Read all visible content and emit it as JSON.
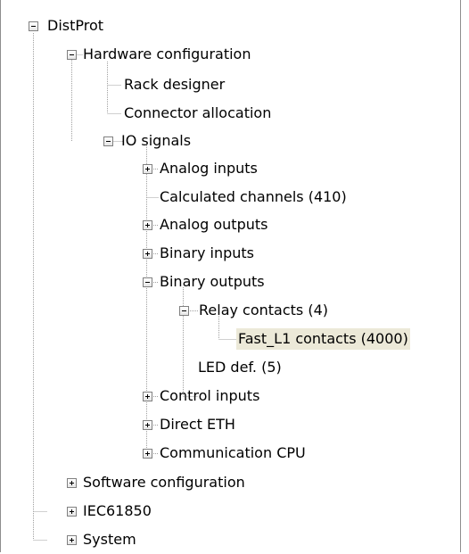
{
  "tree": {
    "nodes": [
      {
        "label": "DistProt",
        "expander": "minus"
      },
      {
        "label": "Hardware configuration",
        "expander": "minus"
      },
      {
        "label": "Rack designer",
        "expander": "none"
      },
      {
        "label": "Connector allocation",
        "expander": "none"
      },
      {
        "label": "IO signals",
        "expander": "minus"
      },
      {
        "label": "Analog inputs",
        "expander": "plus"
      },
      {
        "label": "Calculated channels (410)",
        "expander": "none"
      },
      {
        "label": "Analog outputs",
        "expander": "plus"
      },
      {
        "label": "Binary inputs",
        "expander": "plus"
      },
      {
        "label": "Binary outputs",
        "expander": "minus"
      },
      {
        "label": "Relay contacts (4)",
        "expander": "minus"
      },
      {
        "label": "Fast_L1 contacts (4000)",
        "expander": "none",
        "selected": true
      },
      {
        "label": "LED def. (5)",
        "expander": "none"
      },
      {
        "label": "Control inputs",
        "expander": "plus"
      },
      {
        "label": "Direct ETH",
        "expander": "plus"
      },
      {
        "label": "Communication CPU",
        "expander": "plus"
      },
      {
        "label": "Software configuration",
        "expander": "plus"
      },
      {
        "label": "IEC61850",
        "expander": "plus"
      },
      {
        "label": "System",
        "expander": "plus"
      }
    ]
  },
  "colors": {
    "selection_background": "#ece9d8",
    "connector_line": "#a0a0a0",
    "expander_border": "#808080"
  }
}
